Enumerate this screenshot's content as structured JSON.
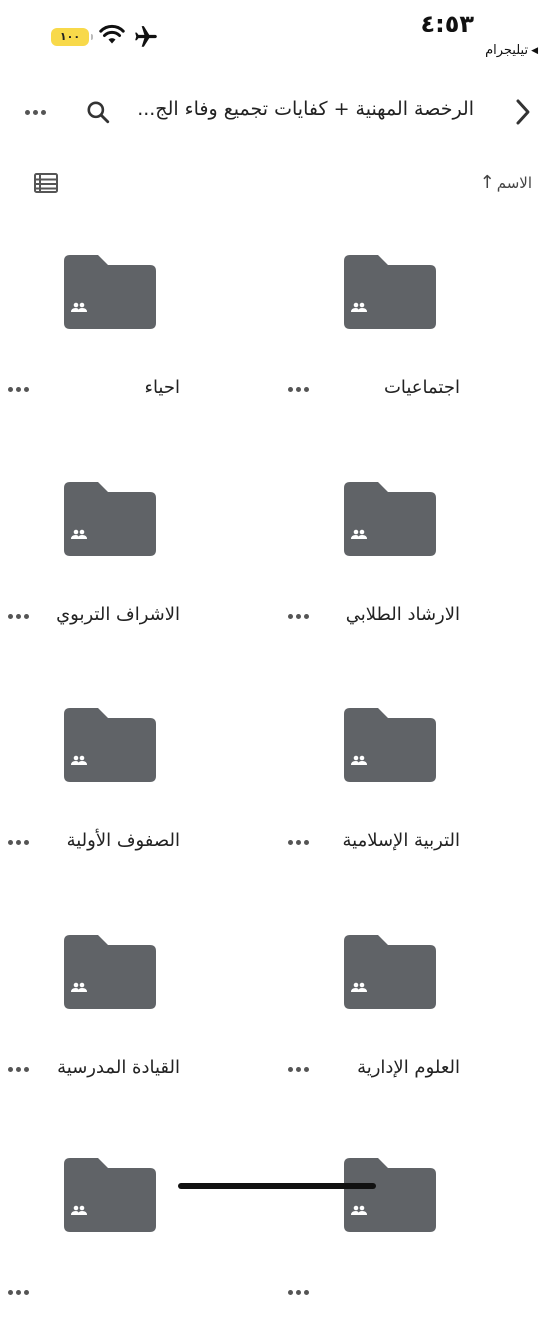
{
  "status_bar": {
    "time": "٤:٥٣",
    "battery": "١٠٠",
    "back_app_label": "تيليجرام",
    "back_triangle": "◀"
  },
  "header": {
    "title": "الرخصة المهنية + كفايات تجميع وفاء الج...",
    "icons": [
      "back-chevron-icon",
      "search-icon",
      "more-icon"
    ]
  },
  "sort": {
    "label": "الاسم",
    "direction_glyph": "↑"
  },
  "folders": [
    {
      "name": "اجتماعيات"
    },
    {
      "name": "احياء"
    },
    {
      "name": "الارشاد الطلابي"
    },
    {
      "name": "الاشراف التربوي"
    },
    {
      "name": "التربية الإسلامية"
    },
    {
      "name": "الصفوف الأولية"
    },
    {
      "name": "العلوم الإدارية"
    },
    {
      "name": "القيادة المدرسية"
    },
    {
      "name": ""
    },
    {
      "name": ""
    }
  ],
  "colors": {
    "folder": "#606367",
    "battery": "#f8d94a",
    "text": "#222222"
  }
}
